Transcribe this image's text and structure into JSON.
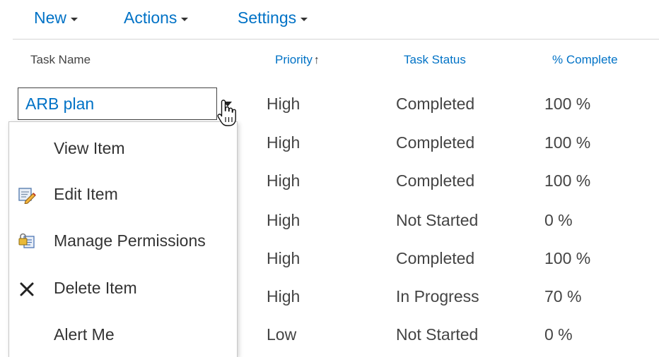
{
  "toolbar": {
    "new_label": "New",
    "actions_label": "Actions",
    "settings_label": "Settings"
  },
  "columns": {
    "task_name": "Task Name",
    "priority": "Priority",
    "priority_sort_glyph": "↑",
    "task_status": "Task Status",
    "percent_complete": "% Complete"
  },
  "rows": [
    {
      "name": "ARB plan",
      "priority": "High",
      "status": "Completed",
      "percent": "100 %"
    },
    {
      "priority": "High",
      "status": "Completed",
      "percent": "100 %"
    },
    {
      "priority": "High",
      "status": "Completed",
      "percent": "100 %"
    },
    {
      "priority": "High",
      "status": "Not Started",
      "percent": "0 %"
    },
    {
      "priority": "High",
      "status": "Completed",
      "percent": "100 %"
    },
    {
      "priority": "High",
      "status": "In Progress",
      "percent": "70 %"
    },
    {
      "priority": "Low",
      "status": "Not Started",
      "percent": "0 %"
    }
  ],
  "context_menu": {
    "items": [
      {
        "label": "View Item",
        "icon": "none"
      },
      {
        "label": "Edit Item",
        "icon": "edit-icon"
      },
      {
        "label": "Manage Permissions",
        "icon": "permissions-icon"
      },
      {
        "label": "Delete Item",
        "icon": "delete-icon"
      },
      {
        "label": "Alert Me",
        "icon": "none"
      }
    ]
  },
  "colors": {
    "link_blue": "#0072c6",
    "text_gray": "#444444"
  }
}
